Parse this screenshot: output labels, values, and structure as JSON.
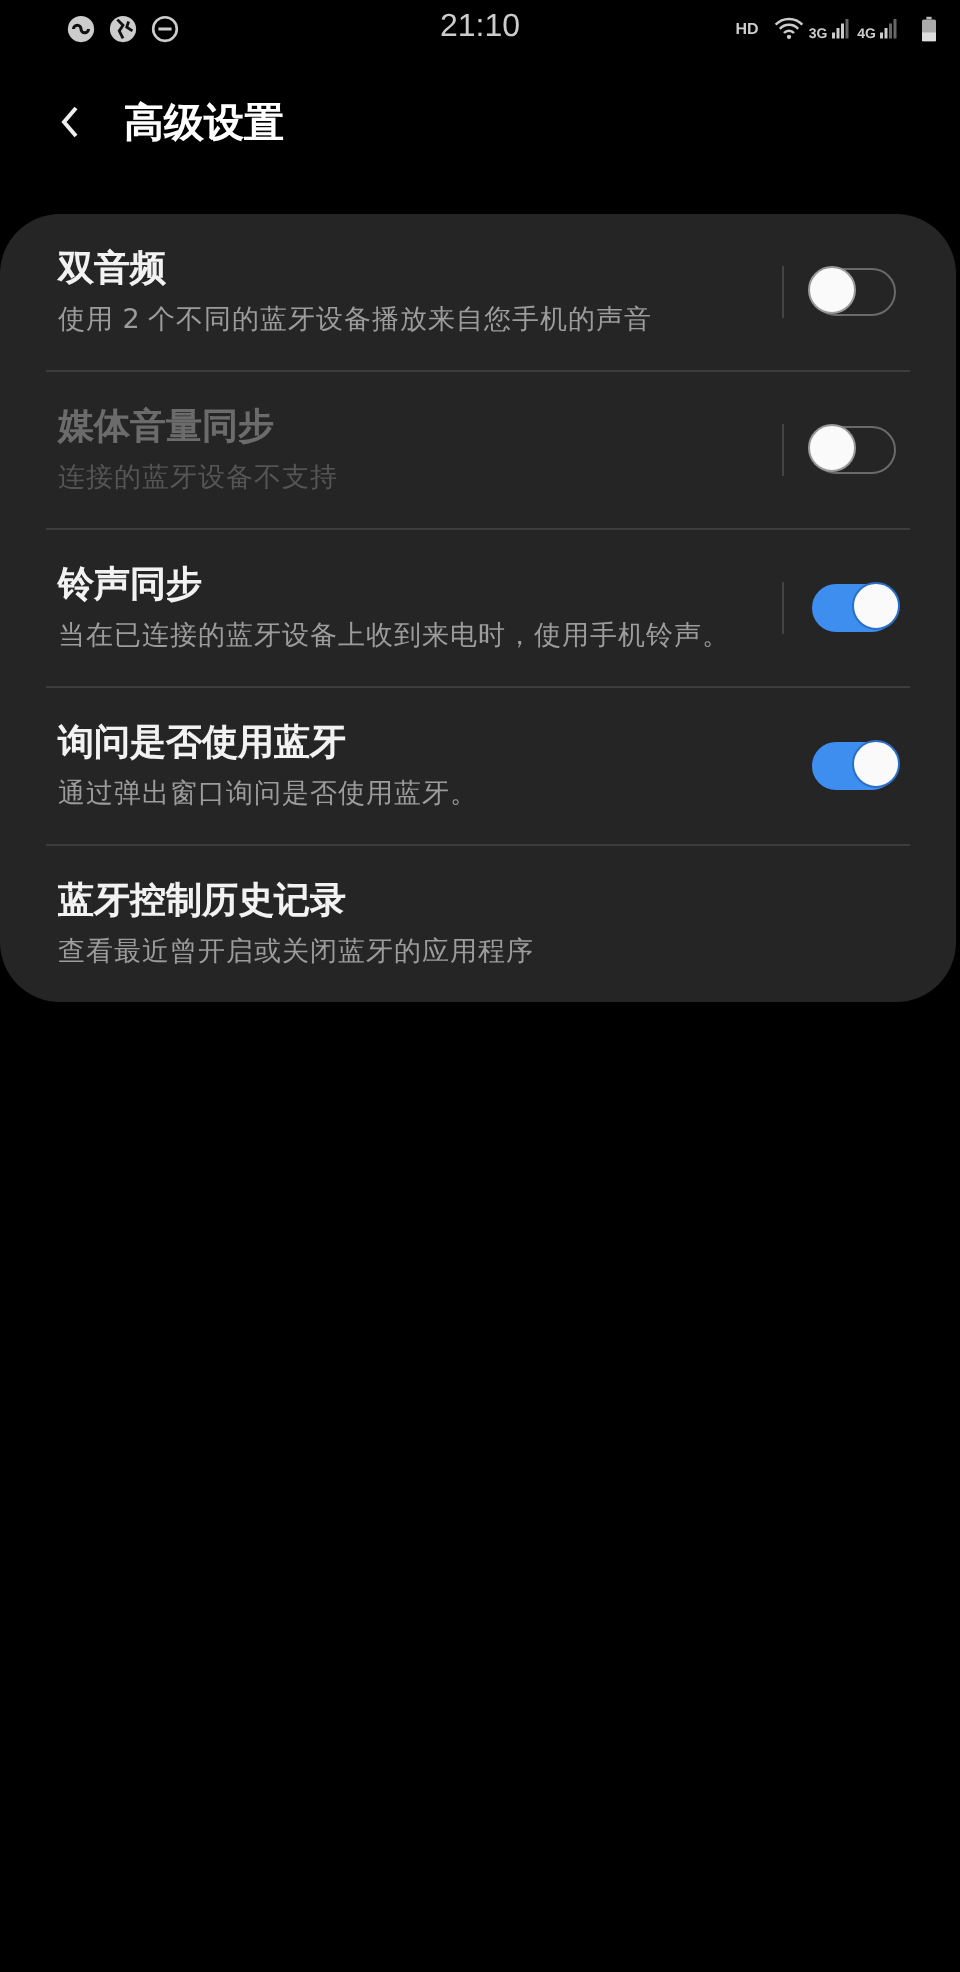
{
  "status_bar": {
    "time": "21:10",
    "network_labels": [
      "HD",
      "3G",
      "4G"
    ]
  },
  "header": {
    "title": "高级设置"
  },
  "settings": [
    {
      "kind": "switch",
      "title": "双音频",
      "subtitle": "使用 2 个不同的蓝牙设备播放来自您手机的声音",
      "on": false,
      "disabled": false,
      "divider": true
    },
    {
      "kind": "switch",
      "title": "媒体音量同步",
      "subtitle": "连接的蓝牙设备不支持",
      "on": false,
      "disabled": true,
      "divider": true
    },
    {
      "kind": "switch",
      "title": "铃声同步",
      "subtitle": "当在已连接的蓝牙设备上收到来电时，使用手机铃声。",
      "on": true,
      "disabled": false,
      "divider": true
    },
    {
      "kind": "switch",
      "title": "询问是否使用蓝牙",
      "subtitle": "通过弹出窗口询问是否使用蓝牙。",
      "on": true,
      "disabled": false,
      "divider": false
    },
    {
      "kind": "link",
      "title": "蓝牙控制历史记录",
      "subtitle": "查看最近曾开启或关闭蓝牙的应用程序",
      "disabled": false
    }
  ]
}
